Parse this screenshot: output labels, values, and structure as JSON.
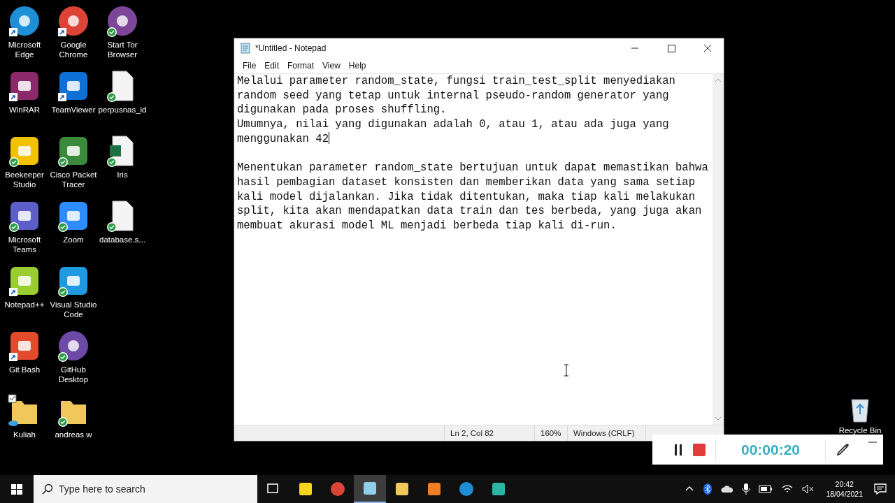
{
  "desktop": {
    "columns": [
      {
        "icons": [
          {
            "label": "Microsoft Edge",
            "kind": "edge",
            "shortcut": true,
            "synced": false,
            "checked": false
          },
          {
            "label": "WinRAR",
            "kind": "archive",
            "shortcut": true,
            "synced": false,
            "checked": false
          },
          {
            "label": "Beekeeper Studio",
            "kind": "beekeeper",
            "shortcut": false,
            "synced": true,
            "checked": false
          },
          {
            "label": "Microsoft Teams",
            "kind": "teams",
            "shortcut": false,
            "synced": true,
            "checked": false
          },
          {
            "label": "Notepad++",
            "kind": "notepadpp",
            "shortcut": true,
            "synced": false,
            "checked": false
          },
          {
            "label": "Git Bash",
            "kind": "git",
            "shortcut": true,
            "synced": false,
            "checked": false
          },
          {
            "label": "Kuliah",
            "kind": "folder",
            "shortcut": false,
            "synced": false,
            "checked": true
          }
        ]
      },
      {
        "icons": [
          {
            "label": "Google Chrome",
            "kind": "chrome",
            "shortcut": true,
            "synced": false,
            "checked": false
          },
          {
            "label": "TeamViewer",
            "kind": "teamviewer",
            "shortcut": true,
            "synced": false,
            "checked": false
          },
          {
            "label": "Cisco Packet Tracer",
            "kind": "cisco",
            "shortcut": false,
            "synced": true,
            "checked": false
          },
          {
            "label": "Zoom",
            "kind": "zoom",
            "shortcut": false,
            "synced": true,
            "checked": false
          },
          {
            "label": "Visual Studio Code",
            "kind": "vscode",
            "shortcut": false,
            "synced": true,
            "checked": false
          },
          {
            "label": "GitHub Desktop",
            "kind": "github",
            "shortcut": false,
            "synced": true,
            "checked": false
          },
          {
            "label": "andreas w",
            "kind": "folder",
            "shortcut": false,
            "synced": true,
            "checked": false
          }
        ]
      },
      {
        "icons": [
          {
            "label": "Start Tor Browser",
            "kind": "tor",
            "shortcut": false,
            "synced": true,
            "checked": false
          },
          {
            "label": "perpusnas_id",
            "kind": "document",
            "shortcut": false,
            "synced": true,
            "checked": false
          },
          {
            "label": "Iris",
            "kind": "spreadsheet",
            "shortcut": false,
            "synced": true,
            "checked": false
          },
          {
            "label": "database.s...",
            "kind": "blank",
            "shortcut": false,
            "synced": true,
            "checked": false
          }
        ]
      }
    ],
    "recycle_bin": {
      "label": "Recycle Bin"
    }
  },
  "window": {
    "title": "*Untitled - Notepad",
    "menu": [
      "File",
      "Edit",
      "Format",
      "View",
      "Help"
    ],
    "blocks": [
      {
        "lines": [
          {
            "text": "Melalui parameter random_state, fungsi train_test_split menyediakan",
            "caret": false
          },
          {
            "text": "random seed yang tetap untuk internal pseudo-random generator yang",
            "caret": false
          },
          {
            "text": "digunakan pada proses shuffling.",
            "caret": false
          },
          {
            "text": "Umumnya, nilai yang digunakan adalah 0, atau 1, atau ada juga yang",
            "caret": false
          },
          {
            "text": "menggunakan 42",
            "caret": true
          }
        ]
      },
      {
        "lines": [
          {
            "text": "Menentukan parameter random_state bertujuan untuk dapat memastikan bahwa",
            "caret": false
          },
          {
            "text": "hasil pembagian dataset konsisten dan memberikan data yang sama setiap",
            "caret": false
          },
          {
            "text": "kali model dijalankan. Jika tidak ditentukan, maka tiap kali melakukan",
            "caret": false
          },
          {
            "text": "split, kita akan mendapatkan data train dan tes berbeda, yang juga akan",
            "caret": false
          },
          {
            "text": "membuat akurasi model ML menjadi berbeda tiap kali di-run.",
            "caret": false
          }
        ]
      }
    ],
    "status_bar": {
      "position": "Ln 2, Col 82",
      "zoom": "160%",
      "line_endings": "Windows (CRLF)"
    }
  },
  "recorder": {
    "timer": "00:00:20",
    "paused": false
  },
  "taskbar": {
    "search": {
      "placeholder": "Type here to search"
    },
    "apps": [
      {
        "kind": "taskview",
        "selected": false
      },
      {
        "kind": "sticky",
        "selected": false
      },
      {
        "kind": "chrome",
        "selected": false
      },
      {
        "kind": "notepad",
        "selected": true
      },
      {
        "kind": "explorer",
        "selected": false
      },
      {
        "kind": "xampp",
        "selected": false
      },
      {
        "kind": "edge",
        "selected": false
      },
      {
        "kind": "recorder",
        "selected": false
      }
    ],
    "time": "20:42",
    "date": "18/04/2021"
  }
}
